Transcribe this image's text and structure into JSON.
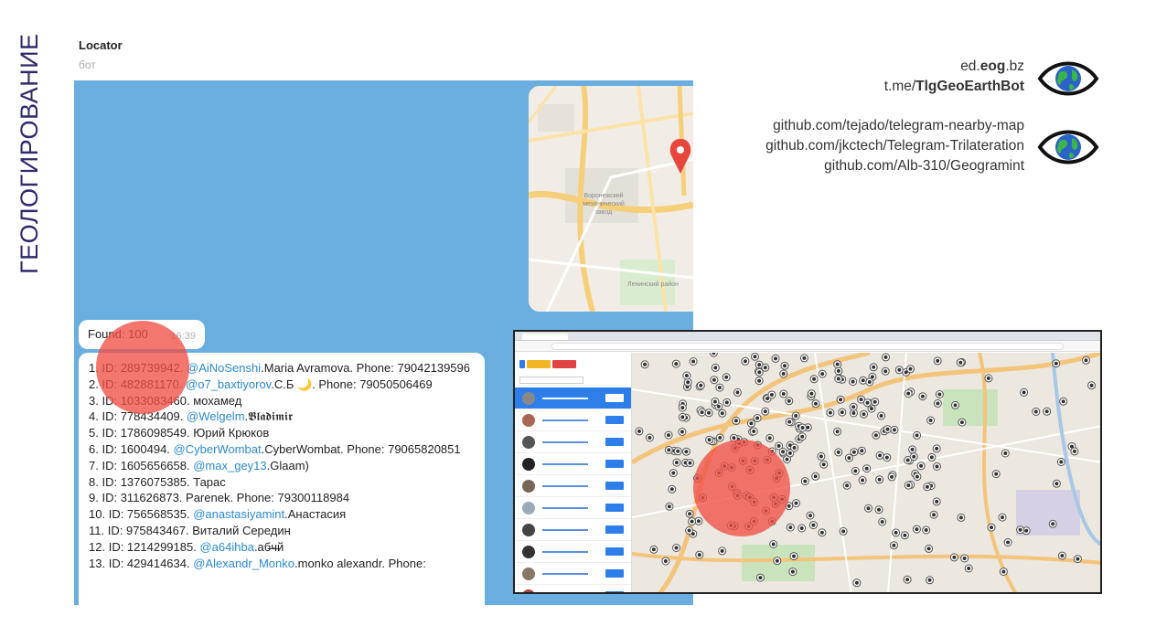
{
  "slide": {
    "vertical_title": "ГЕОЛОГИРОВАНИЕ"
  },
  "chat": {
    "title": "Locator",
    "subtitle": "бот",
    "found": {
      "text": "Found: 100",
      "time": "16:39"
    },
    "results": [
      {
        "num": "1.",
        "id": "ID: 289739942.",
        "handle": "@AiNoSenshi",
        "rest": ".Maria Avramova. Phone: 79042139596"
      },
      {
        "num": "2.",
        "id": "ID: 482881170.",
        "handle": "@o7_baxtiyorov",
        "rest": ".С.Б 🌙. Phone: 79050506469"
      },
      {
        "num": "3.",
        "id": "ID: 1033083460.",
        "handle": "",
        "rest": " мохамед"
      },
      {
        "num": "4.",
        "id": "ID: 778434409.",
        "handle": "@Welgelm",
        "rest": ".𝕭𝖑𝖆𝖉𝖎𝖒𝖎𝖗"
      },
      {
        "num": "5.",
        "id": "ID: 1786098549.",
        "handle": "",
        "rest": " Юрий Крюков"
      },
      {
        "num": "6.",
        "id": "ID: 1600494.",
        "handle": "@CyberWombat",
        "rest": ".CyberWombat. Phone: 79065820851"
      },
      {
        "num": "7.",
        "id": "ID: 1605656658.",
        "handle": "@max_gey13",
        "rest": ".Glaam)"
      },
      {
        "num": "8.",
        "id": "ID: 1376075385.",
        "handle": "",
        "rest": " Тарас"
      },
      {
        "num": "9.",
        "id": "ID: 311626873.",
        "handle": "",
        "rest": " Parenek. Phone: 79300118984"
      },
      {
        "num": "10.",
        "id": "ID: 756568535.",
        "handle": "@anastasiyamint",
        "rest": ".Анастасия"
      },
      {
        "num": "11.",
        "id": "ID: 975843467.",
        "handle": "",
        "rest": " Виталий Середин"
      },
      {
        "num": "12.",
        "id": "ID: 1214299185.",
        "handle": "@a64ihba",
        "rest": ".аб̶ч̶й"
      },
      {
        "num": "13.",
        "id": "ID: 429414634.",
        "handle": "@Alexandr_Monko",
        "rest": ".monko alexandr. Phone:"
      }
    ],
    "map_preview": {
      "label1": "Воронежский механический завод",
      "label2": "Ленинский район"
    }
  },
  "links": {
    "group1": {
      "line1_pre": "ed.",
      "line1_bold": "eog",
      "line1_post": ".bz",
      "line2_pre": "t.me/",
      "line2_bold": "TlgGeoEarthBot"
    },
    "group2": [
      "github.com/tejado/telegram-nearby-map",
      "github.com/jkctech/Telegram-Trilateration",
      "github.com/Alb-310/Geogramint"
    ]
  },
  "icons": {
    "eye1": "eye-globe-icon",
    "eye2": "eye-globe-icon",
    "map_pin": "map-pin-icon"
  },
  "colors": {
    "accent_title": "#2e2a6b",
    "telegram_bg": "#6aaee0",
    "link": "#2a8ad0",
    "highlight": "#f05046"
  }
}
